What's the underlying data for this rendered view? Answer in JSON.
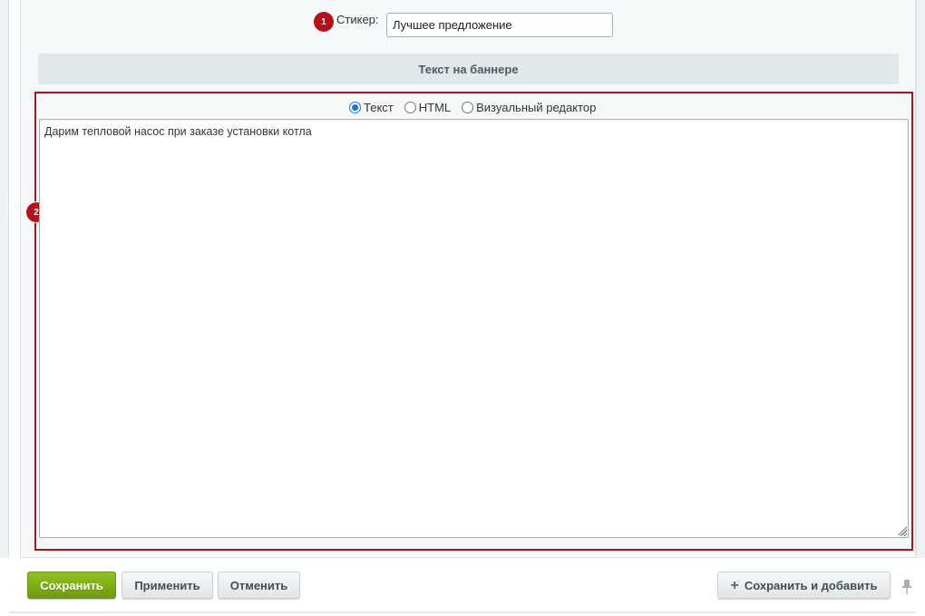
{
  "sticker": {
    "marker": "1",
    "label": "Стикер:",
    "value": "Лучшее предложение"
  },
  "banner_section": {
    "title": "Текст на баннере",
    "marker": "2",
    "modes": [
      {
        "label": "Текст",
        "checked": true
      },
      {
        "label": "HTML",
        "checked": false
      },
      {
        "label": "Визуальный редактор",
        "checked": false
      }
    ],
    "text": "Дарим тепловой насос при заказе установки котла"
  },
  "footer": {
    "save_label": "Сохранить",
    "apply_label": "Применить",
    "cancel_label": "Отменить",
    "save_add_label": "Сохранить и добавить"
  },
  "colors": {
    "marker": "#b3121b",
    "save_button": "#7fae16",
    "section_header": "#e0e8ea"
  }
}
